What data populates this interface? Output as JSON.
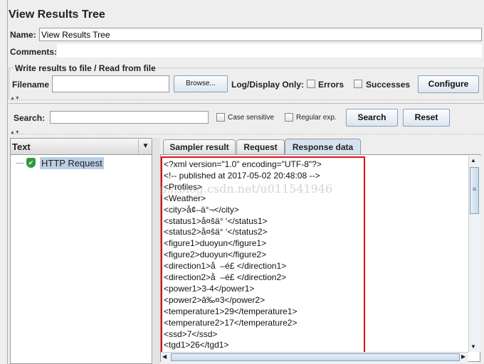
{
  "title": "View Results Tree",
  "name": {
    "label": "Name:",
    "value": "View Results Tree"
  },
  "comments": {
    "label": "Comments:"
  },
  "file_section": {
    "legend": "Write results to file / Read from file",
    "filename_label": "Filename",
    "filename_value": "",
    "browse": "Browse...",
    "log_display": "Log/Display Only:",
    "errors": "Errors",
    "successes": "Successes",
    "configure": "Configure"
  },
  "search": {
    "label": "Search:",
    "value": "",
    "case_sensitive": "Case sensitive",
    "regex": "Regular exp.",
    "search_btn": "Search",
    "reset_btn": "Reset"
  },
  "tree": {
    "header": "Text",
    "items": [
      {
        "label": "HTTP Request",
        "status": "success"
      }
    ]
  },
  "tabs": [
    {
      "label": "Sampler result"
    },
    {
      "label": "Request"
    },
    {
      "label": "Response data",
      "selected": true
    }
  ],
  "response_lines": [
    "<?xml version=\"1.0\" encoding=\"UTF-8\"?>",
    "<!-- published at 2017-05-02 20:48:08 -->",
    "<Profiles>",
    "<Weather>",
    "<city>å¢–ä°¬</city>",
    "<status1>å¤šä° ‘</status1>",
    "<status2>å¤šä° ‘</status2>",
    "<figure1>duoyun</figure1>",
    "<figure2>duoyun</figure2>",
    "<direction1>å  –é£ </direction1>",
    "<direction2>å  –é£ </direction2>",
    "<power1>3-4</power1>",
    "<power2>â‰¤3</power2>",
    "<temperature1>29</temperature1>",
    "<temperature2>17</temperature2>",
    "<ssd>7</ssd>",
    "<tgd1>26</tgd1>"
  ],
  "watermark": "http://blog.csdn.net/u011541946",
  "colors": {
    "highlight_box": "#dd1111",
    "selection": "#b8cfe5",
    "success_icon": "#2e9a3a"
  }
}
